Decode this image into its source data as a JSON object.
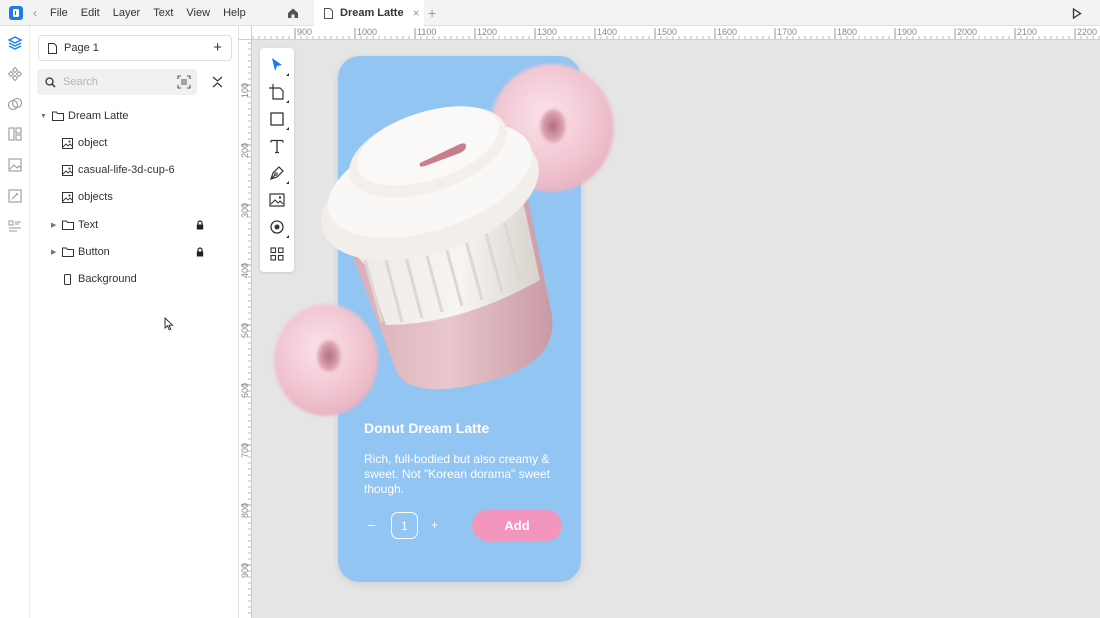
{
  "menu": [
    "File",
    "Edit",
    "Layer",
    "Text",
    "View",
    "Help"
  ],
  "tab": {
    "title": "Dream Latte"
  },
  "panel": {
    "page_label": "Page 1",
    "search_placeholder": "Search",
    "layers": [
      {
        "name": "Dream Latte",
        "type": "folder"
      },
      {
        "name": "object",
        "type": "image"
      },
      {
        "name": "casual-life-3d-cup-6",
        "type": "image"
      },
      {
        "name": "objects",
        "type": "image"
      },
      {
        "name": "Text",
        "type": "folder"
      },
      {
        "name": "Button",
        "type": "folder"
      },
      {
        "name": "Background",
        "type": "rect"
      }
    ]
  },
  "ruler": {
    "top": [
      "900",
      "1000",
      "1100",
      "1200",
      "1300",
      "1400",
      "1500",
      "1600",
      "1700",
      "1800",
      "1900",
      "2000",
      "2100",
      "2200"
    ],
    "left": [
      "100",
      "200",
      "300",
      "400",
      "500",
      "600",
      "700",
      "800",
      "900"
    ]
  },
  "card": {
    "title": "Donut Dream Latte",
    "description": "Rich, full-bodied but also creamy & sweet. Not \"Korean dorama\" sweet though.",
    "qty_minus": "–",
    "quantity": "1",
    "qty_plus": "+",
    "add_label": "Add"
  },
  "colors": {
    "card_bg": "#92c5f2",
    "accent": "#f396be",
    "brand": "#1b7cf0"
  }
}
